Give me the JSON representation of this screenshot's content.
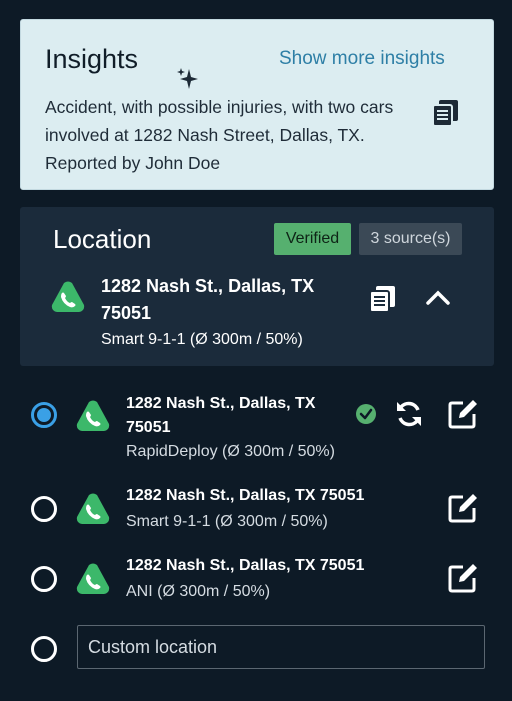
{
  "insights": {
    "title": "Insights",
    "link": "Show more insights",
    "text": "Accident, with possible injuries, with two cars involved at 1282 Nash Street, Dallas, TX. Reported by John Doe"
  },
  "location": {
    "title": "Location",
    "verified_badge": "Verified",
    "sources_badge": "3 source(s)",
    "address": "1282 Nash St., Dallas, TX 75051",
    "source": "Smart 9-1-1 (Ø 300m / 50%)"
  },
  "options": [
    {
      "address": "1282 Nash St., Dallas, TX 75051",
      "source": "RapidDeploy (Ø 300m / 50%)",
      "selected": true
    },
    {
      "address": "1282 Nash St., Dallas, TX 75051",
      "source": "Smart 9-1-1 (Ø 300m / 50%)",
      "selected": false
    },
    {
      "address": "1282 Nash St., Dallas, TX 75051",
      "source": "ANI (Ø 300m / 50%)",
      "selected": false
    }
  ],
  "custom_location": {
    "placeholder": "Custom location"
  },
  "colors": {
    "phone_icon": "#3cb86a",
    "verified": "#56b06f",
    "radio_selected": "#3aa0e6",
    "link": "#2e7fa6"
  }
}
